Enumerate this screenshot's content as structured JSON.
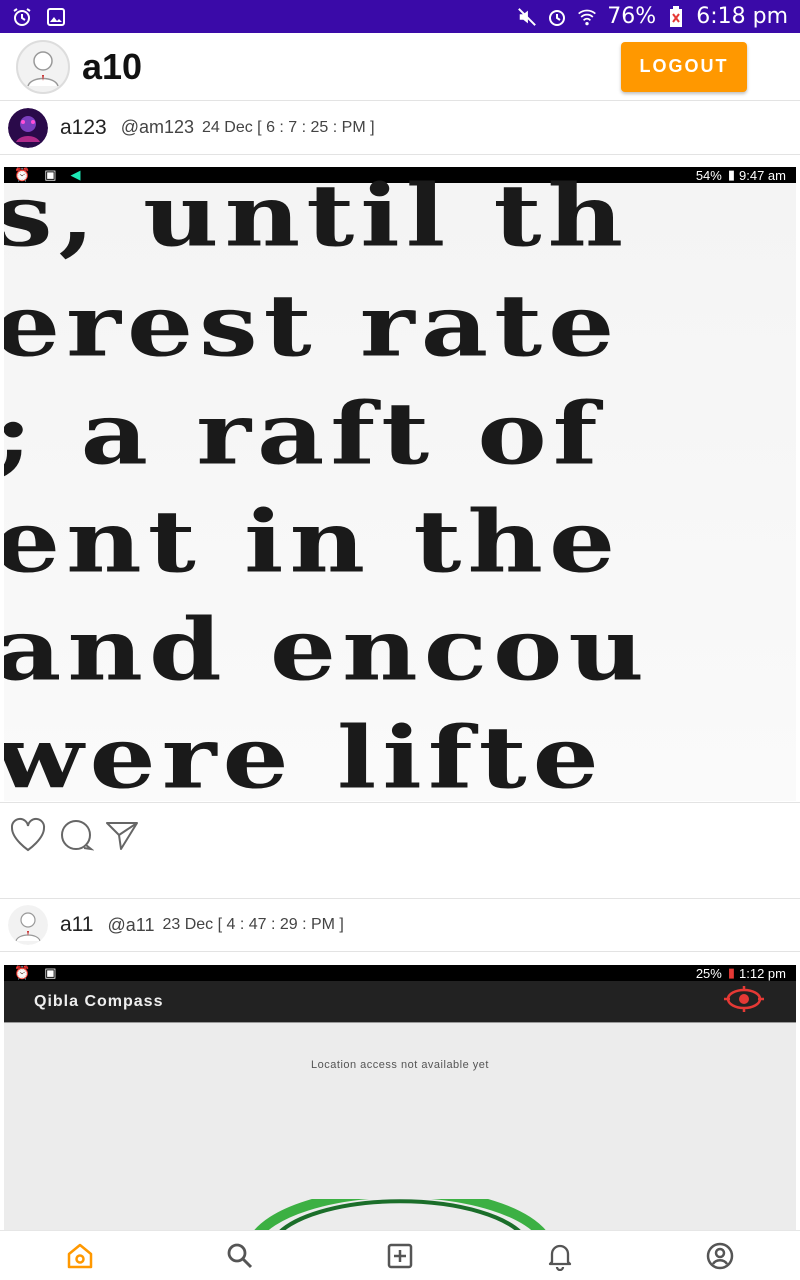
{
  "status_bar": {
    "battery": "76%",
    "time": "6:18 pm"
  },
  "app_bar": {
    "username": "a10",
    "logout_label": "LOGOUT",
    "accent": "#ff9800"
  },
  "posts": [
    {
      "name": "a123",
      "handle": "@am123",
      "time": "24 Dec [ 6 : 7 : 25 : PM ]",
      "screenshot": {
        "battery": "54%",
        "time": "9:47 am",
        "lines": [
          "s, until th",
          "erest rate",
          "; a raft of",
          "ent in the",
          "and encou",
          "were lifte"
        ]
      }
    },
    {
      "name": "a11",
      "handle": "@a11",
      "time": "23 Dec [ 4 : 47 : 29 : PM ]",
      "screenshot": {
        "battery": "25%",
        "time": "1:12 pm",
        "app_title": "Qibla Compass",
        "message": "Location access not available yet"
      }
    }
  ],
  "nav": {
    "items": [
      "home-icon",
      "search-icon",
      "add-post-icon",
      "notifications-icon",
      "profile-icon"
    ],
    "active": "home-icon",
    "active_color": "#ff9800"
  }
}
